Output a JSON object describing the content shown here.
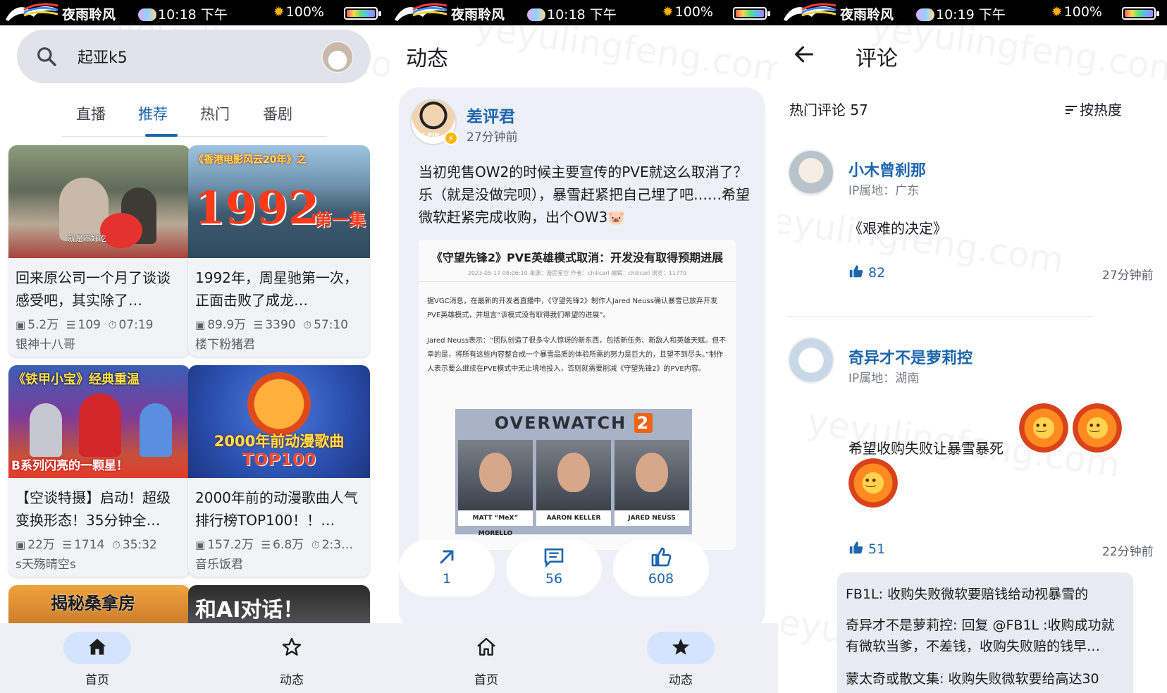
{
  "status": [
    {
      "app": "夜雨聆风",
      "time": "10:18 下午",
      "battery": "100%"
    },
    {
      "app": "夜雨聆风",
      "time": "10:18 下午",
      "battery": "100%"
    },
    {
      "app": "夜雨聆风",
      "time": "10:19 下午",
      "battery": "100%"
    }
  ],
  "watermark": "yeyulingfeng.com",
  "home": {
    "search_text": "起亚k5",
    "tabs": [
      "直播",
      "推荐",
      "热门",
      "番剧"
    ],
    "active_tab": "推荐",
    "cards": [
      {
        "title": "回来原公司一个月了谈谈感受吧，其实除了…",
        "views": "5.2万",
        "danmaku": "109",
        "duration": "07:19",
        "author": "银神十八哥",
        "thumb_caption": "就是不好吃"
      },
      {
        "title": "1992年，周星驰第一次，正面击败了成龙…",
        "views": "89.9万",
        "danmaku": "3390",
        "duration": "57:10",
        "author": "楼下粉猪君",
        "thumb_top": "《香港电影风云20年》之",
        "thumb_big": "1992",
        "thumb_side": "第一集"
      },
      {
        "title": "【空谈特摄】启动！超级变换形态！35分钟全…",
        "views": "22万",
        "danmaku": "1714",
        "duration": "35:32",
        "author": "s天殇晴空s",
        "thumb_top": "《铁甲小宝》经典重温",
        "thumb_bottom": "B系列闪亮的一颗星！"
      },
      {
        "title": "2000年前的动漫歌曲人气排行榜TOP100！！…",
        "views": "157.2万",
        "danmaku": "6.8万",
        "duration": "2:3…",
        "author": "音乐饭君",
        "thumb_top": "2000年前动漫歌曲",
        "thumb_bottom": "TOP100"
      },
      {
        "thumb_text": "揭秘桑拿房"
      },
      {
        "thumb_text": "和AI对话！"
      }
    ]
  },
  "nav": {
    "home": "首页",
    "dynamic": "动态"
  },
  "dynamic": {
    "title": "动态",
    "post": {
      "name": "差评君",
      "time": "27分钟前",
      "avatar_text": "X.PIN",
      "text": "当初兜售OW2的时候主要宣传的PVE就这么取消了？乐（就是没做完呗），暴雪赶紧把自己埋了吧……希望微软赶紧完成收购，出个OW3🐷",
      "article_title": "《守望先锋2》PVE英雄模式取消：开发没有取得预期进展",
      "article_meta": "2023-05-17 08:06:10 来源：游民星空 作者：chilicarl 编辑：chilicarl 浏览：11779",
      "article_p1": "据VGC消息，在最新的开发者直播中，《守望先锋2》制作人Jared Neuss确认暴雪已放弃开发PVE英雄模式，并坦言“该模式没有取得我们希望的进展”。",
      "article_p2": "Jared Neuss表示：“团队创造了很多令人惊讶的新东西，包括新任务、新敌人和英雄天赋。但不幸的是，将所有这些内容整合成一个暴雪品质的体验所需的努力是巨大的，且望不到尽头。”制作人表示要么继续在PVE模式中无止境地投入，否则就需要削减《守望先锋2》的PVE内容。",
      "ow_title": "OVERWATCH",
      "ow_num": "2",
      "faces": [
        {
          "name": "MATT “MeX” MORELLO"
        },
        {
          "name": "AARON KELLER"
        },
        {
          "name": "JARED NEUSS"
        }
      ],
      "forwards": "1",
      "comments": "56",
      "likes": "608"
    }
  },
  "comments": {
    "title": "评论",
    "hot_label": "热门评论 57",
    "sort_label": "按热度",
    "items": [
      {
        "name": "小木曾刹那",
        "ip": "IP属地：广东",
        "text": "《艰难的决定》",
        "likes": "82",
        "time": "27分钟前"
      },
      {
        "name": "奇异才不是萝莉控",
        "ip": "IP属地：湖南",
        "text": "希望收购失败让暴雪暴死",
        "likes": "51",
        "time": "22分钟前"
      }
    ],
    "replies": [
      "FB1L: 收购失败微软要赔钱给动视暴雪的",
      "奇异才不是萝莉控: 回复 @FB1L :收购成功就有微软当爹，不差钱，收购失败赔的钱早…",
      "蒙太奇或散文集: 收购失败微软要给高达30"
    ]
  }
}
